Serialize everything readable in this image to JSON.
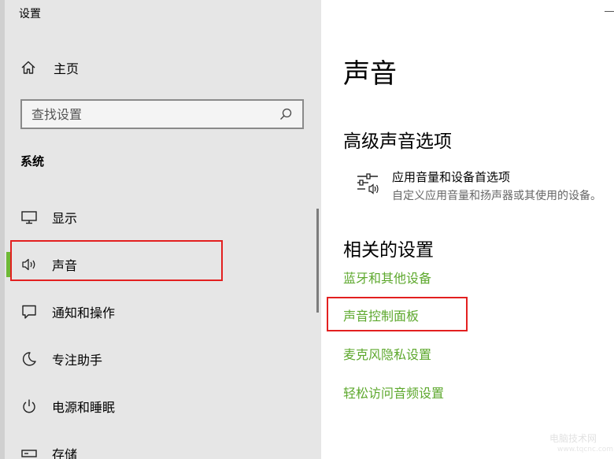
{
  "window": {
    "title": "设置"
  },
  "sidebar": {
    "home_label": "主页",
    "search_placeholder": "查找设置",
    "section_label": "系统",
    "items": [
      {
        "label": "显示",
        "icon": "monitor-icon"
      },
      {
        "label": "声音",
        "icon": "speaker-icon",
        "active": true
      },
      {
        "label": "通知和操作",
        "icon": "notification-icon"
      },
      {
        "label": "专注助手",
        "icon": "moon-icon"
      },
      {
        "label": "电源和睡眠",
        "icon": "power-icon"
      },
      {
        "label": "存储",
        "icon": "storage-icon"
      }
    ]
  },
  "main": {
    "title": "声音",
    "advanced_heading": "高级声音选项",
    "app_volume": {
      "title": "应用音量和设备首选项",
      "subtitle": "自定义应用音量和扬声器或其使用的设备。"
    },
    "related_heading": "相关的设置",
    "related_links": [
      "蓝牙和其他设备",
      "声音控制面板",
      "麦克风隐私设置",
      "轻松访问音频设置"
    ]
  },
  "watermark": {
    "line1": "电脑技术网",
    "line2": "www.tqcnc.com"
  },
  "colors": {
    "accent": "#6fb936",
    "link": "#5da82d",
    "highlight": "#e32020",
    "sidebar_bg": "#e6e6e6"
  }
}
